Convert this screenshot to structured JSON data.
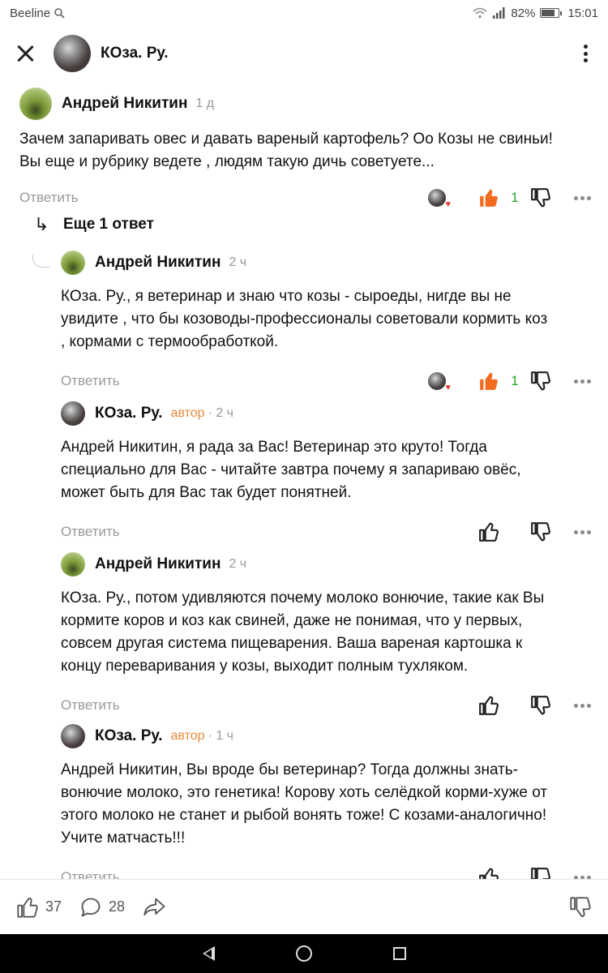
{
  "status_bar": {
    "carrier": "Beeline",
    "battery": "82%",
    "battery_level": 0.82,
    "time": "15:01"
  },
  "app_bar": {
    "channel_name": "КОза. Ру."
  },
  "colors": {
    "accent_orange": "#e8893a",
    "like_orange": "#f26c1f",
    "like_count_green": "#2aa52a",
    "muted_gray": "#999999"
  },
  "comments": [
    {
      "author": "Андрей Никитин",
      "time": "1 д",
      "text_lines": [
        "Зачем запаривать овес и давать вареный картофель? Оо Козы не свиньи!",
        "Вы еще и рубрику ведете , людям такую дичь советуете..."
      ],
      "reply_label": "Ответить",
      "like_count": "1"
    },
    {
      "author": "Андрей Никитин",
      "time": "2 ч",
      "text_lines": [
        "КОза. Ру., я ветеринар и знаю что козы - сыроеды, нигде вы не",
        "увидите , что бы козоводы-профессионалы советовали кормить коз",
        ", кормами с термообработкой."
      ],
      "reply_label": "Ответить",
      "like_count": "1"
    },
    {
      "author": "КОза. Ру.",
      "badge": "автор",
      "time": "· 2 ч",
      "text_lines": [
        "Андрей Никитин, я рада за Вас! Ветеринар это круто! Тогда",
        "специально для Вас - читайте завтра почему я запариваю овёс,",
        "может быть для Вас так будет понятней."
      ],
      "reply_label": "Ответить"
    },
    {
      "author": "Андрей Никитин",
      "time": "2 ч",
      "text_lines": [
        "КОза. Ру., потом удивляются почему молоко вонючие, такие как Вы",
        "кормите коров и коз как свиней, даже не понимая, что у первых,",
        "совсем другая система пищеварения. Ваша вареная картошка к",
        "концу переваривания у козы, выходит полным тухляком."
      ],
      "reply_label": "Ответить"
    },
    {
      "author": "КОза. Ру.",
      "badge": "автор",
      "time": "· 1 ч",
      "text_lines": [
        "Андрей Никитин, Вы вроде бы ветеринар? Тогда должны знать-",
        "вонючие молоко, это генетика! Корову хоть селёдкой корми-хуже от",
        "этого молоко не станет и рыбой вонять тоже! С козами-аналогично!",
        "Учите матчасть!!!"
      ],
      "reply_label": "Ответить"
    }
  ],
  "more_replies": {
    "label": "Еще 1 ответ"
  },
  "bottom_bar": {
    "likes": "37",
    "comments": "28"
  },
  "icons": [
    "close-icon",
    "more-vert-icon",
    "thumbs-up-icon",
    "thumbs-down-icon",
    "more-horiz-icon",
    "reply-arrow-icon",
    "comment-icon",
    "share-icon",
    "back-icon",
    "home-icon",
    "recents-icon"
  ]
}
